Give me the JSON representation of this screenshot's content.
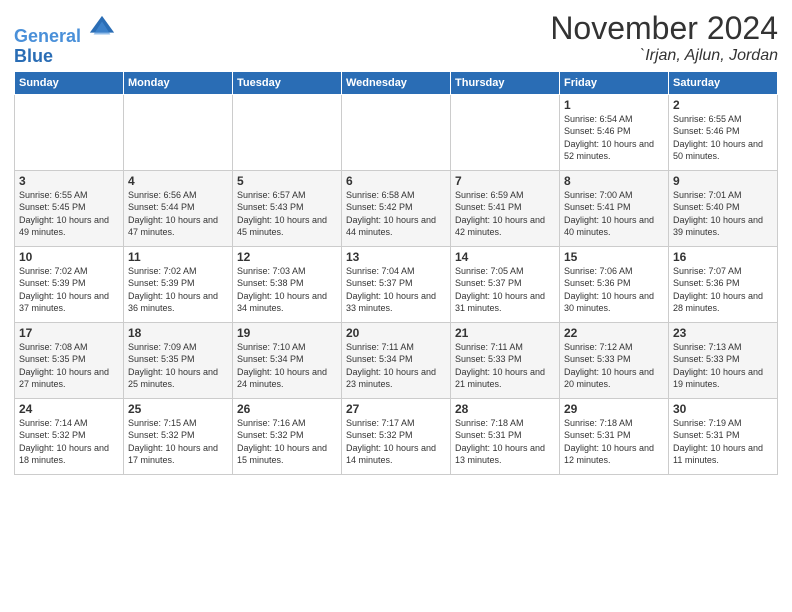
{
  "logo": {
    "line1": "General",
    "line2": "Blue"
  },
  "title": "November 2024",
  "location": "`Irjan, Ajlun, Jordan",
  "weekdays": [
    "Sunday",
    "Monday",
    "Tuesday",
    "Wednesday",
    "Thursday",
    "Friday",
    "Saturday"
  ],
  "weeks": [
    [
      {
        "day": "",
        "info": ""
      },
      {
        "day": "",
        "info": ""
      },
      {
        "day": "",
        "info": ""
      },
      {
        "day": "",
        "info": ""
      },
      {
        "day": "",
        "info": ""
      },
      {
        "day": "1",
        "info": "Sunrise: 6:54 AM\nSunset: 5:46 PM\nDaylight: 10 hours\nand 52 minutes."
      },
      {
        "day": "2",
        "info": "Sunrise: 6:55 AM\nSunset: 5:46 PM\nDaylight: 10 hours\nand 50 minutes."
      }
    ],
    [
      {
        "day": "3",
        "info": "Sunrise: 6:55 AM\nSunset: 5:45 PM\nDaylight: 10 hours\nand 49 minutes."
      },
      {
        "day": "4",
        "info": "Sunrise: 6:56 AM\nSunset: 5:44 PM\nDaylight: 10 hours\nand 47 minutes."
      },
      {
        "day": "5",
        "info": "Sunrise: 6:57 AM\nSunset: 5:43 PM\nDaylight: 10 hours\nand 45 minutes."
      },
      {
        "day": "6",
        "info": "Sunrise: 6:58 AM\nSunset: 5:42 PM\nDaylight: 10 hours\nand 44 minutes."
      },
      {
        "day": "7",
        "info": "Sunrise: 6:59 AM\nSunset: 5:41 PM\nDaylight: 10 hours\nand 42 minutes."
      },
      {
        "day": "8",
        "info": "Sunrise: 7:00 AM\nSunset: 5:41 PM\nDaylight: 10 hours\nand 40 minutes."
      },
      {
        "day": "9",
        "info": "Sunrise: 7:01 AM\nSunset: 5:40 PM\nDaylight: 10 hours\nand 39 minutes."
      }
    ],
    [
      {
        "day": "10",
        "info": "Sunrise: 7:02 AM\nSunset: 5:39 PM\nDaylight: 10 hours\nand 37 minutes."
      },
      {
        "day": "11",
        "info": "Sunrise: 7:02 AM\nSunset: 5:39 PM\nDaylight: 10 hours\nand 36 minutes."
      },
      {
        "day": "12",
        "info": "Sunrise: 7:03 AM\nSunset: 5:38 PM\nDaylight: 10 hours\nand 34 minutes."
      },
      {
        "day": "13",
        "info": "Sunrise: 7:04 AM\nSunset: 5:37 PM\nDaylight: 10 hours\nand 33 minutes."
      },
      {
        "day": "14",
        "info": "Sunrise: 7:05 AM\nSunset: 5:37 PM\nDaylight: 10 hours\nand 31 minutes."
      },
      {
        "day": "15",
        "info": "Sunrise: 7:06 AM\nSunset: 5:36 PM\nDaylight: 10 hours\nand 30 minutes."
      },
      {
        "day": "16",
        "info": "Sunrise: 7:07 AM\nSunset: 5:36 PM\nDaylight: 10 hours\nand 28 minutes."
      }
    ],
    [
      {
        "day": "17",
        "info": "Sunrise: 7:08 AM\nSunset: 5:35 PM\nDaylight: 10 hours\nand 27 minutes."
      },
      {
        "day": "18",
        "info": "Sunrise: 7:09 AM\nSunset: 5:35 PM\nDaylight: 10 hours\nand 25 minutes."
      },
      {
        "day": "19",
        "info": "Sunrise: 7:10 AM\nSunset: 5:34 PM\nDaylight: 10 hours\nand 24 minutes."
      },
      {
        "day": "20",
        "info": "Sunrise: 7:11 AM\nSunset: 5:34 PM\nDaylight: 10 hours\nand 23 minutes."
      },
      {
        "day": "21",
        "info": "Sunrise: 7:11 AM\nSunset: 5:33 PM\nDaylight: 10 hours\nand 21 minutes."
      },
      {
        "day": "22",
        "info": "Sunrise: 7:12 AM\nSunset: 5:33 PM\nDaylight: 10 hours\nand 20 minutes."
      },
      {
        "day": "23",
        "info": "Sunrise: 7:13 AM\nSunset: 5:33 PM\nDaylight: 10 hours\nand 19 minutes."
      }
    ],
    [
      {
        "day": "24",
        "info": "Sunrise: 7:14 AM\nSunset: 5:32 PM\nDaylight: 10 hours\nand 18 minutes."
      },
      {
        "day": "25",
        "info": "Sunrise: 7:15 AM\nSunset: 5:32 PM\nDaylight: 10 hours\nand 17 minutes."
      },
      {
        "day": "26",
        "info": "Sunrise: 7:16 AM\nSunset: 5:32 PM\nDaylight: 10 hours\nand 15 minutes."
      },
      {
        "day": "27",
        "info": "Sunrise: 7:17 AM\nSunset: 5:32 PM\nDaylight: 10 hours\nand 14 minutes."
      },
      {
        "day": "28",
        "info": "Sunrise: 7:18 AM\nSunset: 5:31 PM\nDaylight: 10 hours\nand 13 minutes."
      },
      {
        "day": "29",
        "info": "Sunrise: 7:18 AM\nSunset: 5:31 PM\nDaylight: 10 hours\nand 12 minutes."
      },
      {
        "day": "30",
        "info": "Sunrise: 7:19 AM\nSunset: 5:31 PM\nDaylight: 10 hours\nand 11 minutes."
      }
    ]
  ]
}
